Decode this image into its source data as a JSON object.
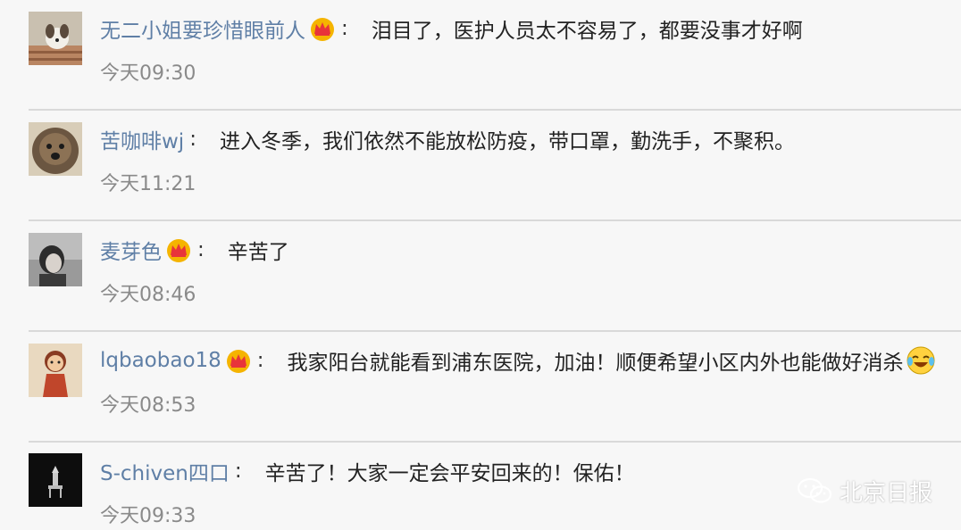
{
  "comments": [
    {
      "nickname": "无二小姐要珍惜眼前人",
      "has_crown": true,
      "colon": ":",
      "text": "泪目了，医护人员太不容易了，都要没事才好啊",
      "time": "今天09:30"
    },
    {
      "nickname": "苦咖啡wj",
      "has_crown": false,
      "colon": ":",
      "text": "进入冬季，我们依然不能放松防疫，带口罩，勤洗手，不聚积。",
      "time": "今天11:21"
    },
    {
      "nickname": "麦芽色",
      "has_crown": true,
      "colon": ":",
      "text": "辛苦了",
      "time": "今天08:46"
    },
    {
      "nickname": "lqbaobao18",
      "has_crown": true,
      "colon": ":",
      "text": "我家阳台就能看到浦东医院，加油！顺便希望小区内外也能做好消杀",
      "emoji": "laughing-crying-emoji",
      "time": "今天08:53"
    },
    {
      "nickname": "S-chiven四口",
      "has_crown": false,
      "colon": ":",
      "text": "辛苦了！大家一定会平安回来的！保佑！",
      "time": "今天09:33"
    }
  ],
  "watermark": {
    "label": "北京日报",
    "icon": "wechat-icon"
  },
  "colors": {
    "nickname": "#5f7fa6",
    "text": "#222222",
    "time": "#8a8a8a",
    "background": "#f7f7f7",
    "divider": "#d9d9d9",
    "crown": "#f5b400"
  }
}
